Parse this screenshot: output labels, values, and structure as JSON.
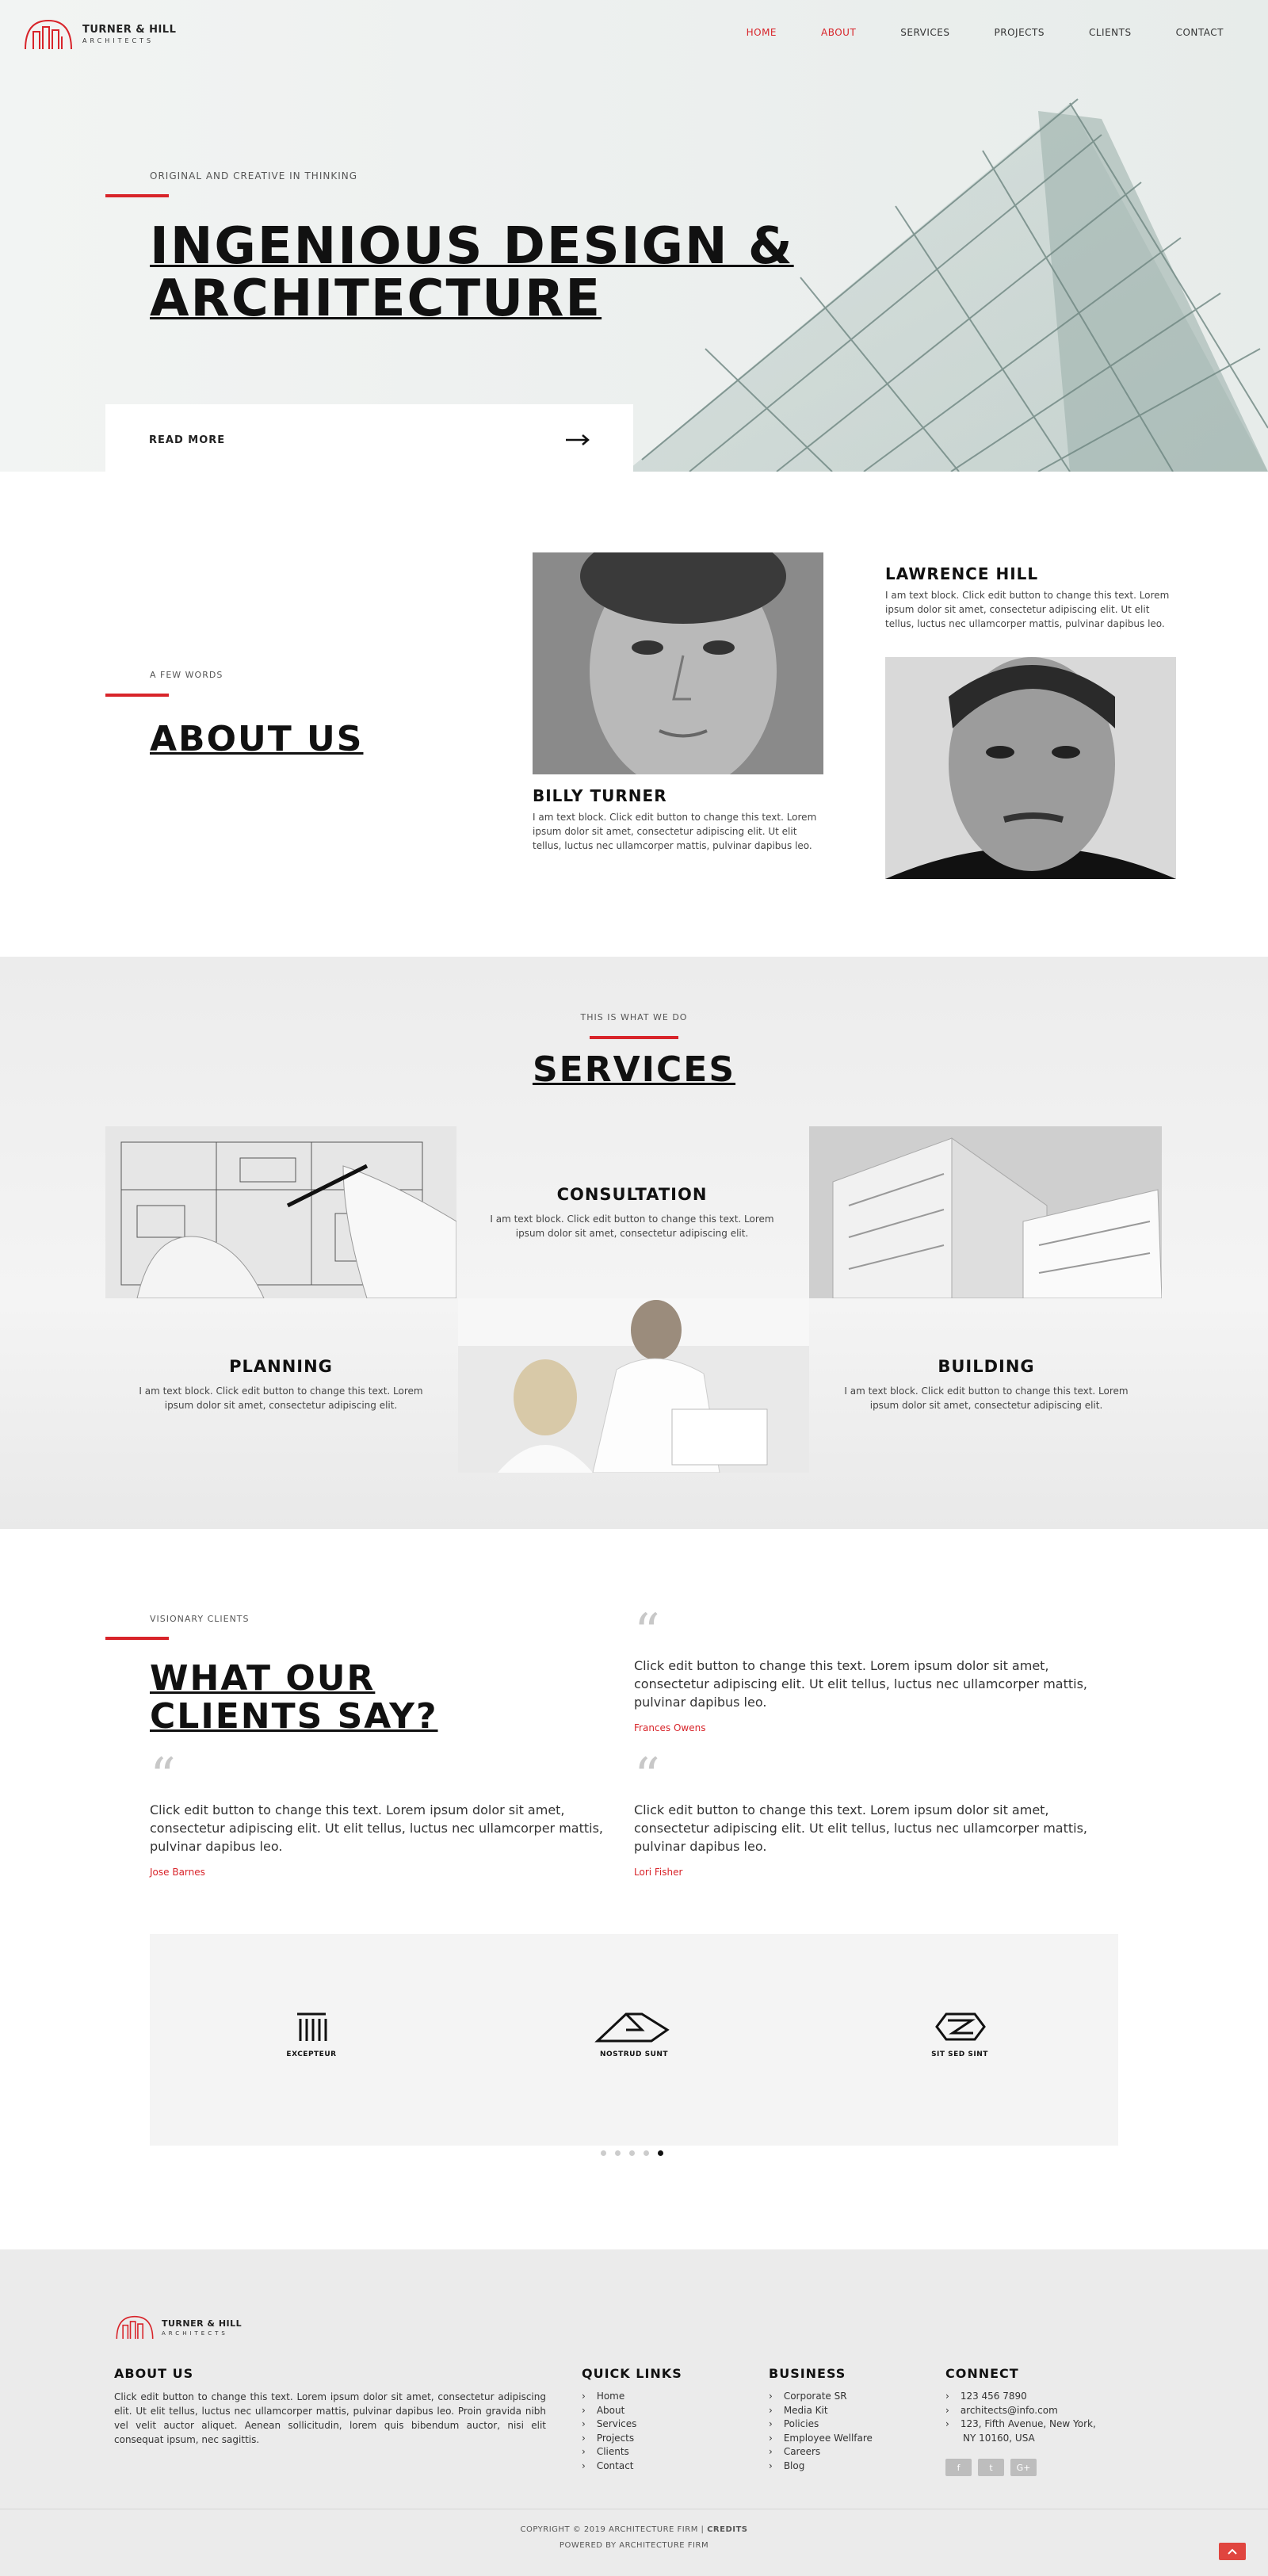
{
  "brand": {
    "name": "TURNER & HILL",
    "sub": "ARCHITECTS",
    "accent": "#d8242a"
  },
  "nav": [
    {
      "label": "HOME",
      "active": true
    },
    {
      "label": "ABOUT",
      "active": true
    },
    {
      "label": "SERVICES",
      "active": false
    },
    {
      "label": "PROJECTS",
      "active": false
    },
    {
      "label": "CLIENTS",
      "active": false
    },
    {
      "label": "CONTACT",
      "active": false
    }
  ],
  "hero": {
    "eyebrow": "ORIGINAL AND CREATIVE IN THINKING",
    "title_line1": "INGENIOUS DESIGN &",
    "title_line2": "ARCHITECTURE",
    "read_more": "READ MORE"
  },
  "about": {
    "eyebrow": "A FEW WORDS",
    "title": "ABOUT US",
    "people": [
      {
        "name": "BILLY TURNER",
        "text": "I am text block. Click edit button to change this text. Lorem ipsum dolor sit amet, consectetur adipiscing elit. Ut elit tellus, luctus nec ullamcorper mattis, pulvinar dapibus leo."
      },
      {
        "name": "LAWRENCE HILL",
        "text": "I am text block. Click edit button to change this text. Lorem ipsum dolor sit amet, consectetur adipiscing elit. Ut elit tellus, luctus nec ullamcorper mattis, pulvinar dapibus leo."
      }
    ]
  },
  "services": {
    "eyebrow": "THIS IS WHAT WE DO",
    "title": "SERVICES",
    "items": [
      {
        "title": "CONSULTATION",
        "text": "I am text block. Click edit button to change this text. Lorem ipsum dolor sit amet, consectetur adipiscing elit."
      },
      {
        "title": "PLANNING",
        "text": "I am text block. Click edit button to change this text. Lorem ipsum dolor sit amet, consectetur adipiscing elit."
      },
      {
        "title": "BUILDING",
        "text": "I am text block. Click edit button to change this text. Lorem ipsum dolor sit amet, consectetur adipiscing elit."
      }
    ]
  },
  "clients": {
    "eyebrow": "VISIONARY CLIENTS",
    "title_line1": "WHAT OUR",
    "title_line2": "CLIENTS SAY?",
    "testimonials": [
      {
        "text": "Click edit button to change this text. Lorem ipsum dolor sit amet, consectetur adipiscing elit. Ut elit tellus, luctus nec ullamcorper mattis, pulvinar dapibus leo.",
        "name": "Frances Owens"
      },
      {
        "text": "Click edit button to change this text. Lorem ipsum dolor sit amet, consectetur adipiscing elit. Ut elit tellus, luctus nec ullamcorper mattis, pulvinar dapibus leo.",
        "name": "Jose Barnes"
      },
      {
        "text": "Click edit button to change this text. Lorem ipsum dolor sit amet, consectetur adipiscing elit. Ut elit tellus, luctus nec ullamcorper mattis, pulvinar dapibus leo.",
        "name": "Lori Fisher"
      }
    ],
    "logos": [
      "EXCEPTEUR",
      "NOSTRUD SUNT",
      "SIT SED SINT"
    ],
    "carousel_pages": 5,
    "carousel_active": 5
  },
  "footer": {
    "about_title": "ABOUT US",
    "about_text": "Click edit button to change this text. Lorem ipsum dolor sit amet, consectetur adipiscing elit. Ut elit tellus, luctus nec ullamcorper mattis, pulvinar dapibus leo. Proin gravida nibh vel velit auctor aliquet. Aenean sollicitudin, lorem quis bibendum auctor, nisi elit consequat ipsum, nec sagittis.",
    "quick_title": "QUICK LINKS",
    "quick_links": [
      "Home",
      "About",
      "Services",
      "Projects",
      "Clients",
      "Contact"
    ],
    "business_title": "BUSINESS",
    "business_links": [
      "Corporate SR",
      "Media Kit",
      "Policies",
      "Employee Wellfare",
      "Careers",
      "Blog"
    ],
    "connect_title": "CONNECT",
    "phone": "123 456 7890",
    "email": "architects@info.com",
    "address_line1": "123, Fifth Avenue, New York,",
    "address_line2": "NY 10160, USA",
    "social": [
      "f",
      "t",
      "G+"
    ],
    "copyright": "COPYRIGHT © 2019 ARCHITECTURE FIRM",
    "credits": "CREDITS",
    "powered": "POWERED BY ARCHITECTURE FIRM"
  }
}
